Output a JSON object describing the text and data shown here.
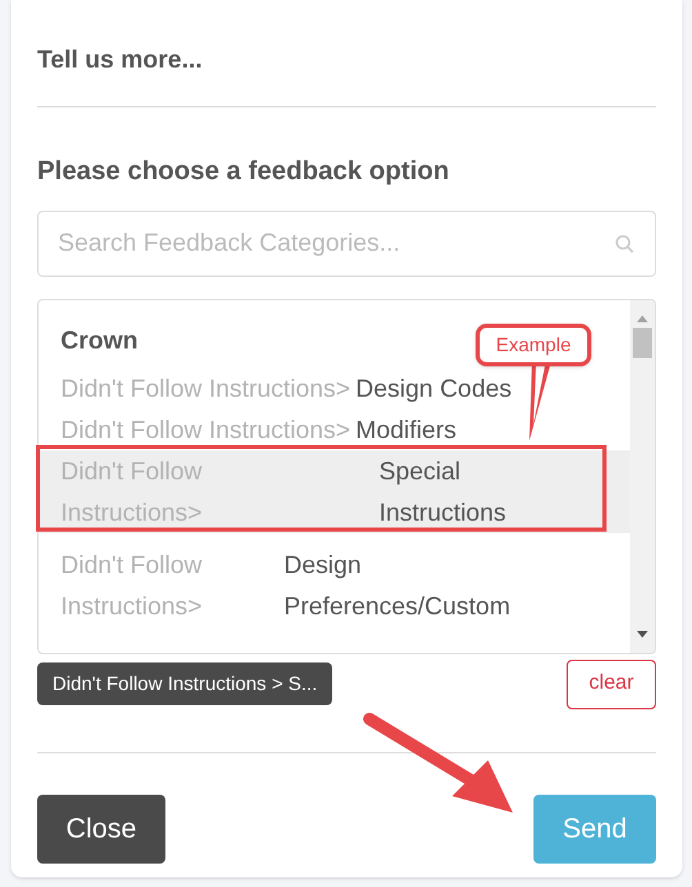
{
  "header": {
    "title": "Tell us more..."
  },
  "prompt": "Please choose a feedback option",
  "search": {
    "placeholder": "Search Feedback Categories..."
  },
  "list": {
    "group": "Crown",
    "items": [
      {
        "prefix": "Didn't Follow Instructions>",
        "name": "Design Codes",
        "kind": "inline",
        "selected": false
      },
      {
        "prefix": "Didn't Follow Instructions>",
        "name": "Modifiers",
        "kind": "inline",
        "selected": false
      },
      {
        "prefix": "Didn't Follow Instructions>",
        "name": "Special Instructions",
        "kind": "wide",
        "selected": true
      },
      {
        "prefix": "Didn't Follow Instructions>",
        "name": "Design Preferences/Custom",
        "kind": "narrow",
        "selected": false
      }
    ]
  },
  "chip": "Didn't Follow Instructions > S...",
  "clear_button": "clear",
  "buttons": {
    "close": "Close",
    "send": "Send"
  },
  "annotations": {
    "callout": "Example"
  }
}
